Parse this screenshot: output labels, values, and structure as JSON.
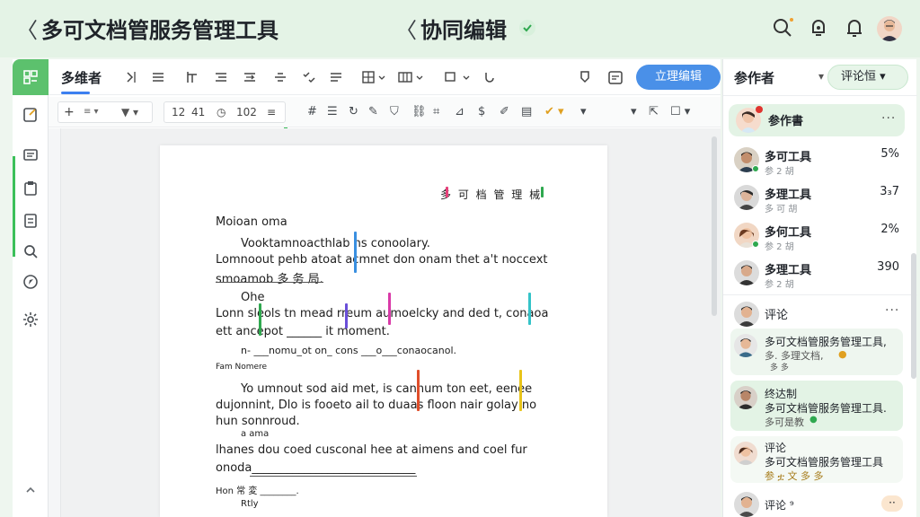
{
  "header": {
    "back_glyph": "〈",
    "app_title": "多可文档管服务管理工具",
    "doc_title": "协同编辑"
  },
  "toolbar": {
    "tab_label": "多维者",
    "publish_label": "立理编辑",
    "font_size_a": "12",
    "font_size_b": "41",
    "font_size_c": "102"
  },
  "document": {
    "header_text": "多 可 档 管 理 械",
    "line1": "Moioan oma",
    "line2": "Vooktamnoacthlab ns conoolary.",
    "line3": "Lomnoout pehb atoat acmnet don onam thet a't noccext",
    "line4": "smoamob 多 务 局.",
    "line5": "Ohe",
    "line6": "Lonn sleols tn mead rreum aumoelcky and ded t, conaoa",
    "line7": "ett ancepot ______ it moment.",
    "line8": "n- ___nomu_ot on_ cons ___o___conaocanol.",
    "line9": "Fam Nomere",
    "line10": "Yo umnout sod aid met, is canhum ton eet, eenee",
    "line11": "dujonnint, Dlo is fooeto ail to duaas floon nair golay no",
    "line12": "hun sonnroud.",
    "line13": "a ama",
    "line14": "lhanes dou coed cusconal hee at aimens and coel fur",
    "line15": "onoda____________________________",
    "line16": "Hon 常 変 ________.",
    "line17": "Rtly"
  },
  "sidebar": {
    "title": "参作者",
    "comment_button": "评论恒",
    "owner_name": "参作書",
    "members": [
      {
        "name": "多可工具",
        "sub": "参 2 胡",
        "value": "5%"
      },
      {
        "name": "多理工具",
        "sub": "多 可 胡",
        "value": "3₃7"
      },
      {
        "name": "多何工具",
        "sub": "参 2 胡",
        "value": "2%"
      },
      {
        "name": "多理工具",
        "sub": "参 2 胡",
        "value": "390"
      }
    ],
    "comments_header": "评论",
    "comments": [
      {
        "line1": "多可文档管服务管理工具,",
        "line2": "多. 多理文档,",
        "line3": "多 多"
      },
      {
        "line1": "终达制",
        "line2": "多可文档管服务管理工具.",
        "line3": "多可是教"
      },
      {
        "line1": "评论",
        "line2": "多可文档管服务管理工具",
        "line3": "参 ቷ 文 多 多"
      }
    ],
    "last_comment": "评论 ⁹"
  },
  "colors": {
    "accent_green": "#5cc16d",
    "accent_blue": "#4a90e8",
    "topbar_bg": "#e4f3e6"
  }
}
